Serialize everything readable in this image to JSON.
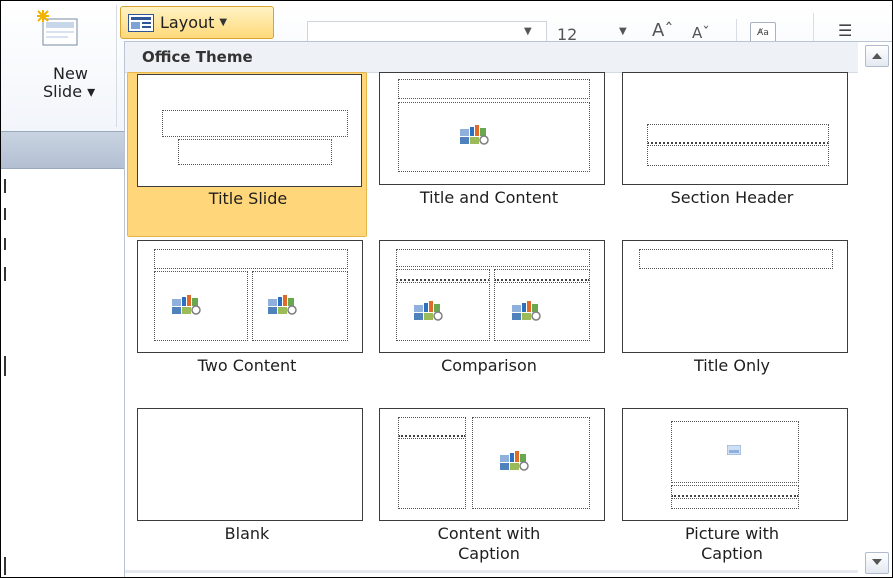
{
  "ribbon": {
    "new_slide_label_line1": "New",
    "new_slide_label_line2": "Slide ▾",
    "layout_button_label": "Layout",
    "font_size": "12",
    "grow_font": "Aˆ",
    "shrink_font": "Aˇ",
    "clear_formatting": "A̸a",
    "bullets": "☰"
  },
  "gallery": {
    "section_title": "Office Theme",
    "layouts": [
      {
        "label": "Title Slide",
        "selected": true
      },
      {
        "label": "Title and Content",
        "selected": false
      },
      {
        "label": "Section Header",
        "selected": false
      },
      {
        "label": "Two Content",
        "selected": false
      },
      {
        "label": "Comparison",
        "selected": false
      },
      {
        "label": "Title Only",
        "selected": false
      },
      {
        "label": "Blank",
        "selected": false
      },
      {
        "label": "Content with Caption",
        "selected": false
      },
      {
        "label": "Picture with Caption",
        "selected": false
      }
    ]
  },
  "icons": {
    "new_slide": "new-slide-icon",
    "layout": "layout-icon",
    "scroll_up": "scroll-up-icon",
    "scroll_down": "scroll-down-icon",
    "content_placeholder": "content-placeholder-icon",
    "picture_placeholder": "picture-placeholder-icon"
  },
  "colors": {
    "selected_fill": "#ffd67a",
    "selected_border": "#e7b548",
    "panel_header": "#eef1f6"
  }
}
